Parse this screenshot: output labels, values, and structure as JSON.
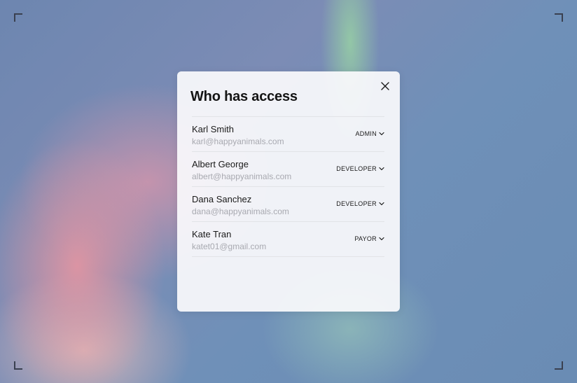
{
  "dialog": {
    "title": "Who has access",
    "close_icon": "close-icon"
  },
  "members": [
    {
      "name": "Karl Smith",
      "email": "karl@happyanimals.com",
      "role": "ADMIN"
    },
    {
      "name": "Albert George",
      "email": "albert@happyanimals.com",
      "role": "DEVELOPER"
    },
    {
      "name": "Dana Sanchez",
      "email": "dana@happyanimals.com",
      "role": "DEVELOPER"
    },
    {
      "name": "Kate Tran",
      "email": "katet01@gmail.com",
      "role": "PAYOR"
    }
  ],
  "colors": {
    "text": "#1a1a1a",
    "muted": "#a8a9b0",
    "divider": "#e2e3e7"
  }
}
